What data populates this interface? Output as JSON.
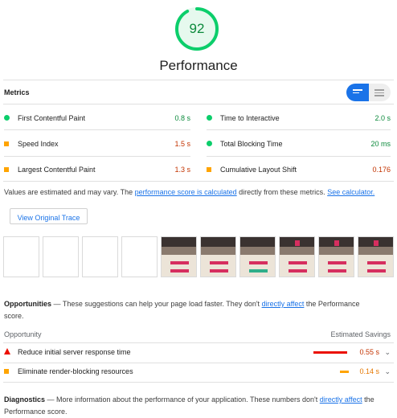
{
  "score": {
    "value": "92",
    "fraction": 0.92,
    "color": "#0cce6b"
  },
  "title": "Performance",
  "metrics_header": "Metrics",
  "metrics": [
    {
      "label": "First Contentful Paint",
      "value": "0.8 s",
      "status": "good"
    },
    {
      "label": "Time to Interactive",
      "value": "2.0 s",
      "status": "good"
    },
    {
      "label": "Speed Index",
      "value": "1.5 s",
      "status": "average"
    },
    {
      "label": "Total Blocking Time",
      "value": "20 ms",
      "status": "good"
    },
    {
      "label": "Largest Contentful Paint",
      "value": "1.3 s",
      "status": "average"
    },
    {
      "label": "Cumulative Layout Shift",
      "value": "0.176",
      "status": "average"
    }
  ],
  "note": {
    "pre": "Values are estimated and may vary. The ",
    "link1": "performance score is calculated",
    "mid": " directly from these metrics. ",
    "link2": "See calculator."
  },
  "trace_button": "View Original Trace",
  "filmstrip_frames": 10,
  "opportunities": {
    "title": "Opportunities",
    "desc_pre": " — These suggestions can help your page load faster. They don't ",
    "desc_link": "directly affect",
    "desc_post": " the Performance",
    "desc_line2": "score.",
    "col_left": "Opportunity",
    "col_right": "Estimated Savings",
    "items": [
      {
        "label": "Reduce initial server response time",
        "value": "0.55 s",
        "severity": "fail"
      },
      {
        "label": "Eliminate render-blocking resources",
        "value": "0.14 s",
        "severity": "average"
      }
    ]
  },
  "diagnostics": {
    "title": "Diagnostics",
    "desc_pre": " — More information about the performance of your application. These numbers don't ",
    "desc_link": "directly affect",
    "desc_post": " the",
    "desc_line2": "Performance score."
  },
  "colors": {
    "good": "#0cce6b",
    "average": "#ffa400",
    "fail": "#eb0f00",
    "accent": "#1a73e8"
  }
}
